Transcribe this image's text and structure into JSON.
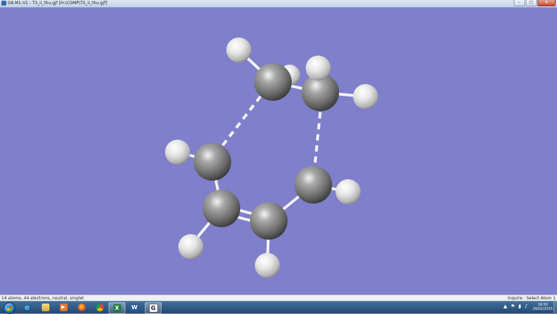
{
  "window": {
    "title": "G6:M1:V1 - TS_ii_thu.gjf [H:\\COMP\\TS_ii_thu.gjf]",
    "minimize_glyph": "–",
    "maximize_glyph": "□",
    "close_glyph": "✕"
  },
  "statusbar": {
    "info": "14 atoms, 44 electrons, neutral, singlet",
    "mode": "Inquire : Select Atom 1"
  },
  "molecule": {
    "atom_count": 14,
    "carbons": 6,
    "hydrogens": 8,
    "forming_bonds": 2,
    "colors": {
      "background": "#7f7fcb",
      "carbon": "#8c8c8c",
      "hydrogen": "#e8e8e8",
      "bond": "#f2f2f2"
    }
  },
  "taskbar": {
    "start_icon": "windows-start-icon",
    "items": [
      {
        "icon": "internet-explorer-icon",
        "label": "e"
      },
      {
        "icon": "file-explorer-icon",
        "label": ""
      },
      {
        "icon": "media-player-icon",
        "label": "▶"
      },
      {
        "icon": "firefox-icon",
        "label": ""
      },
      {
        "icon": "chrome-icon",
        "label": ""
      },
      {
        "icon": "spreadsheet-icon",
        "label": "X"
      },
      {
        "icon": "word-icon",
        "label": "W"
      },
      {
        "icon": "gaussview-icon",
        "label": "G"
      }
    ],
    "tray_icons": [
      "▲",
      "⚑",
      "▮",
      "♪"
    ],
    "time": "18:50",
    "date": "26/02/2015"
  }
}
